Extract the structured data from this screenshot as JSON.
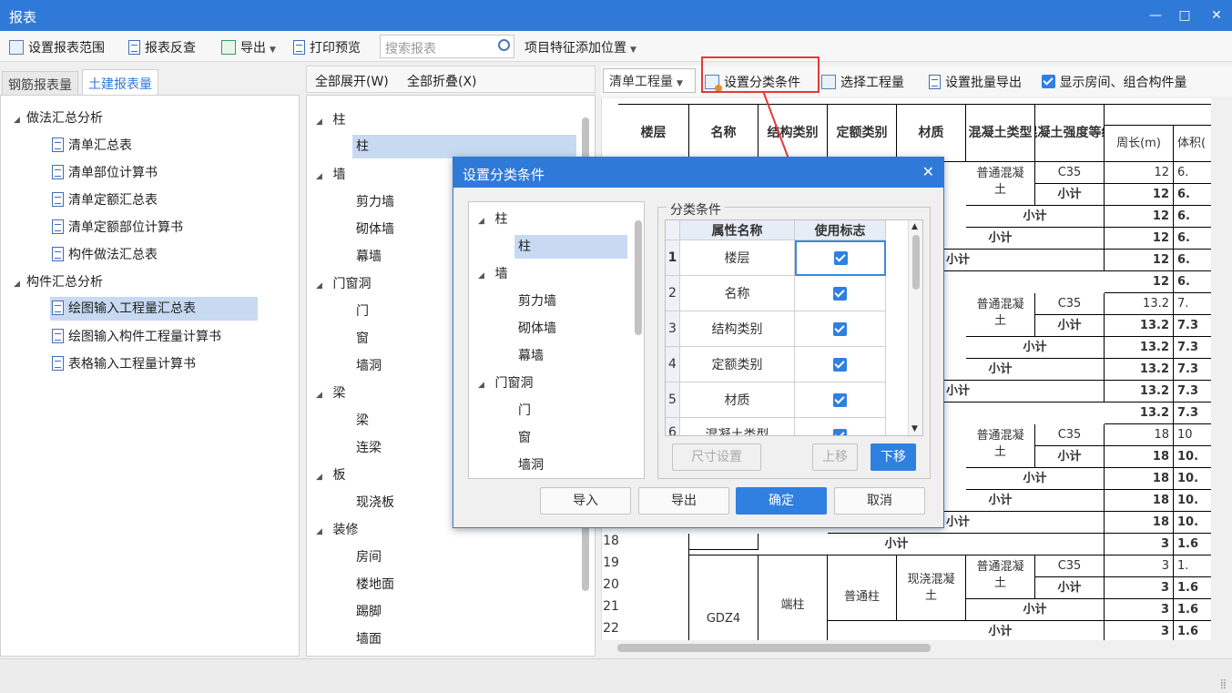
{
  "window": {
    "title": "报表"
  },
  "toolbar": {
    "items": [
      "设置报表范围",
      "报表反查",
      "导出",
      "打印预览"
    ],
    "search_placeholder": "搜索报表",
    "feature_position": "项目特征添加位置"
  },
  "left": {
    "tabs": [
      "钢筋报表量",
      "土建报表量"
    ],
    "groups": [
      {
        "label": "做法汇总分析",
        "items": [
          "清单汇总表",
          "清单部位计算书",
          "清单定额汇总表",
          "清单定额部位计算书",
          "构件做法汇总表"
        ]
      },
      {
        "label": "构件汇总分析",
        "items": [
          "绘图输入工程量汇总表",
          "绘图输入构件工程量计算书",
          "表格输入工程量计算书"
        ]
      }
    ]
  },
  "middle": {
    "expand_all": "全部展开(W)",
    "collapse_all": "全部折叠(X)",
    "tree": [
      {
        "label": "柱",
        "children": [
          "柱"
        ]
      },
      {
        "label": "墙",
        "children": [
          "剪力墙",
          "砌体墙",
          "幕墙"
        ]
      },
      {
        "label": "门窗洞",
        "children": [
          "门",
          "窗",
          "墙洞"
        ]
      },
      {
        "label": "梁",
        "children": [
          "梁",
          "连梁"
        ]
      },
      {
        "label": "板",
        "children": [
          "现浇板"
        ]
      },
      {
        "label": "装修",
        "children": [
          "房间",
          "楼地面",
          "踢脚",
          "墙面"
        ]
      }
    ]
  },
  "right": {
    "combo": "清单工程量",
    "set_classify": "设置分类条件",
    "select_quantity": "选择工程量",
    "batch_export": "设置批量导出",
    "show_rooms": "显示房间、组合构件量"
  },
  "grid": {
    "headers": [
      "楼层",
      "名称",
      "结构类别",
      "定额类别",
      "材质",
      "混凝土类型",
      "混凝土强度等级",
      "周长(m)",
      "体积("
    ],
    "concrete_type": "普通混凝土",
    "grade": "C35",
    "subtotal": "小计",
    "vals": [
      "12",
      "6.",
      "13.2",
      "7.",
      "7.3",
      "18",
      "10",
      "10.",
      "3",
      "1.",
      "1.6"
    ],
    "row_numbers": [
      "18",
      "19",
      "20",
      "21",
      "22"
    ],
    "last": {
      "name": "GDZ4",
      "struct": "端柱",
      "quota": "普通柱",
      "material": "现浇混凝土"
    }
  },
  "dialog": {
    "title": "设置分类条件",
    "tree": [
      {
        "label": "柱",
        "children": [
          "柱"
        ]
      },
      {
        "label": "墙",
        "children": [
          "剪力墙",
          "砌体墙",
          "幕墙"
        ]
      },
      {
        "label": "门窗洞",
        "children": [
          "门",
          "窗",
          "墙洞"
        ]
      }
    ],
    "legend": "分类条件",
    "col_attr": "属性名称",
    "col_use": "使用标志",
    "rows": [
      {
        "no": "1",
        "name": "楼层",
        "use": true
      },
      {
        "no": "2",
        "name": "名称",
        "use": true
      },
      {
        "no": "3",
        "name": "结构类别",
        "use": true
      },
      {
        "no": "4",
        "name": "定额类别",
        "use": true
      },
      {
        "no": "5",
        "name": "材质",
        "use": true
      },
      {
        "no": "6",
        "name": "混凝土类型",
        "use": true
      }
    ],
    "size_btn": "尺寸设置",
    "up_btn": "上移",
    "down_btn": "下移",
    "import": "导入",
    "export": "导出",
    "ok": "确定",
    "cancel": "取消"
  },
  "colors": {
    "accent": "#2f7ad8",
    "highlight": "#e53935",
    "selection": "#c8daf2"
  }
}
